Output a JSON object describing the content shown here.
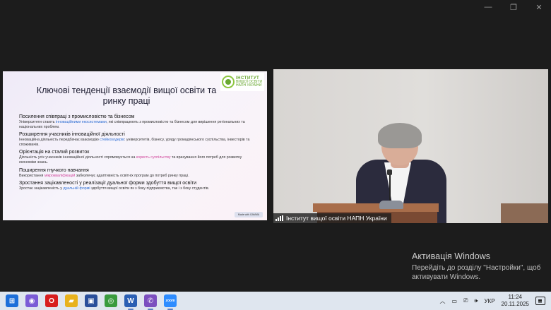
{
  "slide": {
    "logo": {
      "line1": "ІНСТИТУТ",
      "line2": "ВИЩОЇ ОСВІТИ",
      "line3": "НАПН УКРАЇНИ"
    },
    "title": "Ключові тенденції взаємодії вищої освіти та ринку праці",
    "items": [
      {
        "heading": "Посилення співпраці з промисловістю та бізнесом",
        "pre": "Університети стають ",
        "hl": "інноваційними екосистемами",
        "post": ", які співпрацюють з промисловістю та бізнесом для вирішення регіональних та національних проблем.",
        "hl_color": "blue"
      },
      {
        "heading": "Розширення учасників інноваційної діяльності",
        "pre": "Інноваційна діяльність передбачає взаємодію ",
        "hl": "стейкхолдерів",
        "post": ": університетів, бізнесу, уряду громадянського суспільства, інвесторів та споживачів.",
        "hl_color": "blue"
      },
      {
        "heading": "Орієнтація на сталий розвиток",
        "pre": "Діяльність усіх учасників інноваційної діяльності спрямовується на ",
        "hl": "користь суспільству",
        "post": " та врахування його потреб для розвитку економіки знань.",
        "hl_color": "pink"
      },
      {
        "heading": "Поширення гнучкого навчання",
        "pre": "Використання ",
        "hl": "мікрокваліфікацій",
        "post": " забезпечує адаптивність освітніх програм до потреб ринку праці.",
        "hl_color": "pink"
      },
      {
        "heading": "Зростання зацікавленості у реалізації дуальної форми здобуття вищої освіти",
        "pre": "Зростає зацікавленість у ",
        "hl": "дуальній формі",
        "post": " здобуття вищої освіти як з боку підприємства, так і з боку студентів.",
        "hl_color": "blue"
      }
    ],
    "badge": "Made with GAMMA"
  },
  "video": {
    "label": "Інститут вищої освіти НАПН України"
  },
  "activation": {
    "title": "Активація Windows",
    "line1": "Перейдіть до розділу \"Настройки\", щоб",
    "line2": "активувати Windows."
  },
  "taskbar": {
    "apps": [
      {
        "name": "windows-start",
        "glyph": "⊞",
        "color": "#1e6fd9"
      },
      {
        "name": "copilot",
        "glyph": "◉",
        "color": "#7b5cd6"
      },
      {
        "name": "opera",
        "glyph": "O",
        "color": "#d81e1e"
      },
      {
        "name": "file-explorer",
        "glyph": "▰",
        "color": "#e8b21c"
      },
      {
        "name": "save",
        "glyph": "▣",
        "color": "#2a4f9a"
      },
      {
        "name": "chrome",
        "glyph": "◎",
        "color": "#3a9b3e"
      },
      {
        "name": "word",
        "glyph": "W",
        "color": "#2b5fb3"
      },
      {
        "name": "viber",
        "glyph": "✆",
        "color": "#7b4fbf"
      },
      {
        "name": "zoom",
        "glyph": "zoom",
        "color": "#2d8cff"
      }
    ],
    "lang": "УКР",
    "time": "11:24",
    "date": "20.11.2025"
  }
}
